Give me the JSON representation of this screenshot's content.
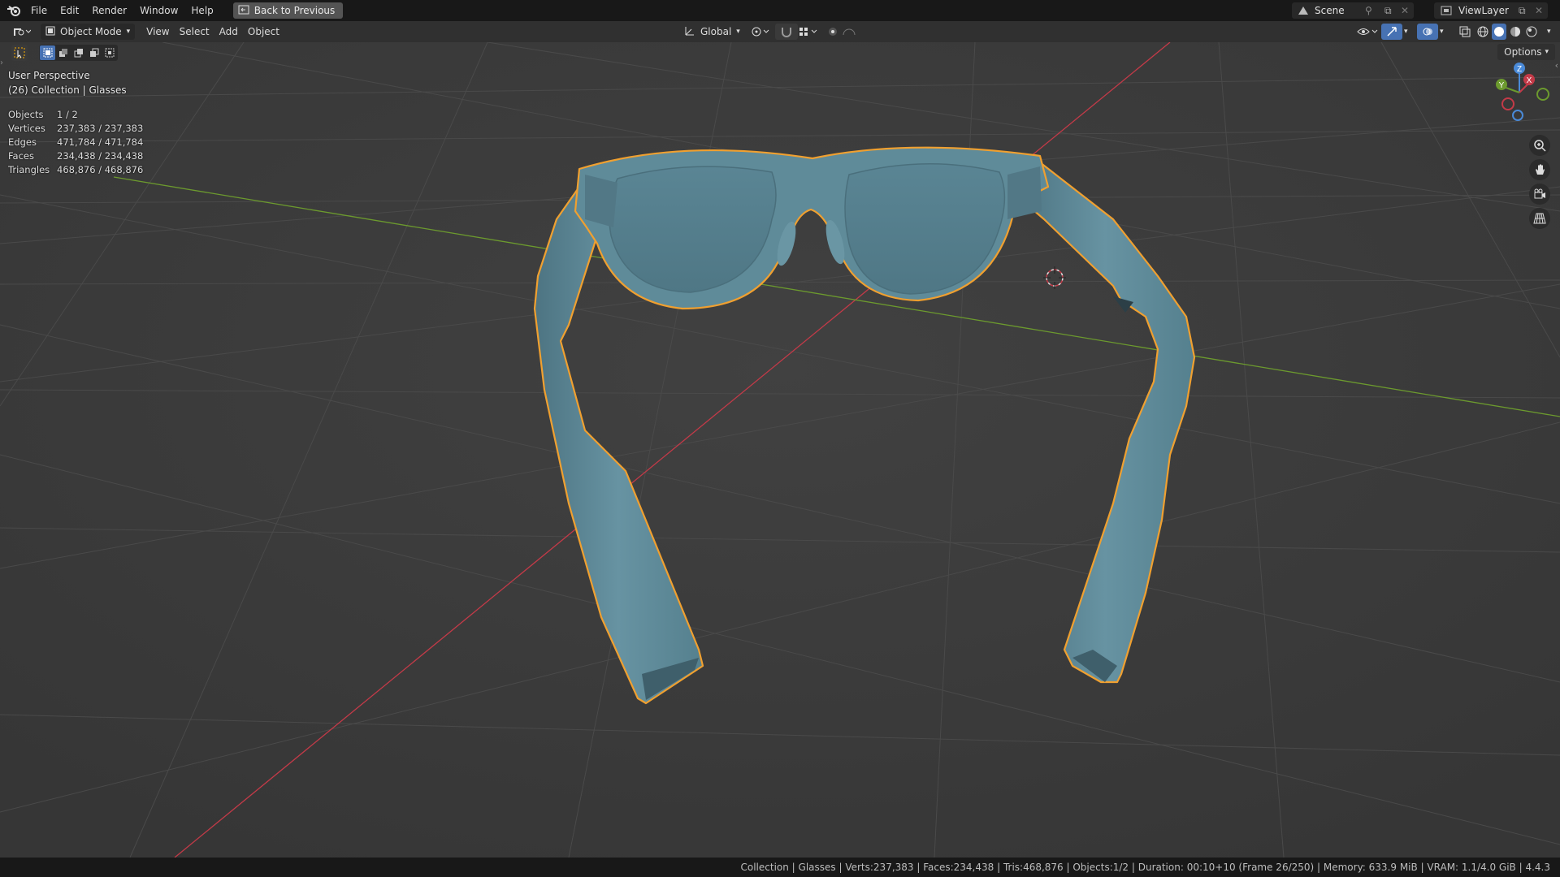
{
  "menubar": {
    "items": [
      "File",
      "Edit",
      "Render",
      "Window",
      "Help"
    ],
    "back_label": "Back to Previous",
    "scene_label": "Scene",
    "view_layer_label": "ViewLayer"
  },
  "header": {
    "mode": "Object Mode",
    "menus": [
      "View",
      "Select",
      "Add",
      "Object"
    ],
    "transform_orientation": "Global",
    "options_label": "Options"
  },
  "overlay": {
    "perspective": "User Perspective",
    "collection": "(26) Collection | Glasses",
    "stats": [
      {
        "key": "Objects",
        "value": "1 / 2"
      },
      {
        "key": "Vertices",
        "value": "237,383 / 237,383"
      },
      {
        "key": "Edges",
        "value": "471,784 / 471,784"
      },
      {
        "key": "Faces",
        "value": "234,438 / 234,438"
      },
      {
        "key": "Triangles",
        "value": "468,876 / 468,876"
      }
    ]
  },
  "gizmo": {
    "z": "Z",
    "x": "X",
    "y": "Y"
  },
  "status": {
    "text": "Collection | Glasses | Verts:237,383 | Faces:234,438 | Tris:468,876 | Objects:1/2 | Duration: 00:10+10 (Frame 26/250) | Memory: 633.9 MiB | VRAM: 1.1/4.0 GiB | 4.4.3"
  },
  "colors": {
    "accent": "#4772b3",
    "selection_outline": "#f0a030",
    "model": "#5d8593",
    "x_axis": "#c33a48",
    "y_axis": "#6c9a2e"
  }
}
